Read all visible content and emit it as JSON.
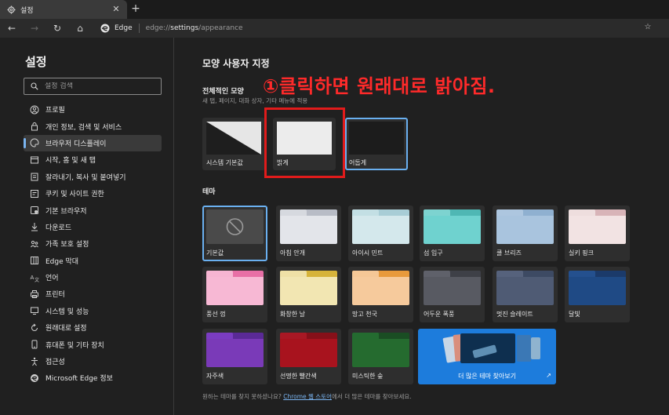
{
  "tab": {
    "title": "설정",
    "close": "✕",
    "new_tab": "+"
  },
  "nav": {
    "back": "←",
    "forward": "→",
    "refresh": "↻",
    "home": "⌂"
  },
  "address": {
    "site_label": "Edge",
    "url_prefix": "edge://",
    "url_bold": "settings",
    "url_suffix": "/appearance"
  },
  "sidebar": {
    "title": "설정",
    "search_placeholder": "설정 검색",
    "items": [
      {
        "label": "프로필",
        "icon": "profile-icon"
      },
      {
        "label": "개인 정보, 검색 및 서비스",
        "icon": "lock-icon"
      },
      {
        "label": "브라우저 디스플레이",
        "icon": "palette-icon",
        "active": true
      },
      {
        "label": "시작, 홈 및 새 탭",
        "icon": "start-icon"
      },
      {
        "label": "잘라내기, 복사 및 붙여넣기",
        "icon": "clipboard-icon"
      },
      {
        "label": "쿠키 및 사이트 권한",
        "icon": "site-permissions-icon"
      },
      {
        "label": "기본 브라우저",
        "icon": "default-browser-icon"
      },
      {
        "label": "다운로드",
        "icon": "download-icon"
      },
      {
        "label": "가족 보호 설정",
        "icon": "family-icon"
      },
      {
        "label": "Edge 막대",
        "icon": "edge-bar-icon"
      },
      {
        "label": "언어",
        "icon": "language-icon"
      },
      {
        "label": "프린터",
        "icon": "printer-icon"
      },
      {
        "label": "시스템 및 성능",
        "icon": "system-icon"
      },
      {
        "label": "원래대로 설정",
        "icon": "reset-icon"
      },
      {
        "label": "휴대폰 및 기타 장치",
        "icon": "phone-icon"
      },
      {
        "label": "접근성",
        "icon": "accessibility-icon"
      },
      {
        "label": "Microsoft Edge 정보",
        "icon": "edge-logo-icon"
      }
    ]
  },
  "main": {
    "title": "모양 사용자 지정",
    "overall_title": "전체적인 모양",
    "overall_sub": "새 탭, 페이지, 대화 상자, 기타 메뉴에 적용",
    "annotation": "①클릭하면 원래대로 밝아짐.",
    "modes": [
      {
        "label": "시스템 기본값"
      },
      {
        "label": "밝게"
      },
      {
        "label": "어둡게",
        "selected": true
      }
    ],
    "theme_title": "테마",
    "themes": [
      {
        "label": "기본값",
        "selected": true,
        "strip": "#3a3a3a",
        "tab": "#3a3a3a",
        "body": "#4a4a4a"
      },
      {
        "label": "아침 안개",
        "strip": "#b8bcc6",
        "tab": "#d6d9df",
        "body": "#e3e5ea"
      },
      {
        "label": "아이시 민트",
        "strip": "#a8cdd6",
        "tab": "#c3dfe4",
        "body": "#d4e8ec"
      },
      {
        "label": "섬 입구",
        "strip": "#4fb7b4",
        "tab": "#7dd3d0",
        "body": "#6fd2cf"
      },
      {
        "label": "쿨 브리즈",
        "strip": "#8fb0d0",
        "tab": "#adc6df",
        "body": "#a9c4de"
      },
      {
        "label": "실키 핑크",
        "strip": "#d8b4b8",
        "tab": "#eedede",
        "body": "#f2e3e3"
      },
      {
        "label": "풍선 껌",
        "strip": "#e86fa6",
        "tab": "#f6b5d2",
        "body": "#f7b8d4"
      },
      {
        "label": "화창한 날",
        "strip": "#d6b33a",
        "tab": "#efe0a6",
        "body": "#f2e6b2"
      },
      {
        "label": "망고 천국",
        "strip": "#e89a3c",
        "tab": "#f5c796",
        "body": "#f6ca9c"
      },
      {
        "label": "어두운 폭풍",
        "strip": "#3e4047",
        "tab": "#5f616a",
        "body": "#585a62"
      },
      {
        "label": "멋진 슬레이트",
        "strip": "#3d4a63",
        "tab": "#56627c",
        "body": "#4f5b74"
      },
      {
        "label": "달빛",
        "strip": "#1b3a6a",
        "tab": "#24508e",
        "body": "#1f4a85"
      },
      {
        "label": "자주색",
        "strip": "#5a2a96",
        "tab": "#7a3cc0",
        "body": "#7a3ab8"
      },
      {
        "label": "선명한 빨간색",
        "strip": "#861019",
        "tab": "#a81824",
        "body": "#a8131e"
      },
      {
        "label": "미스틱한 숲",
        "strip": "#1a4d23",
        "tab": "#246b30",
        "body": "#256b2f"
      }
    ],
    "more_themes": {
      "label": "더 많은 테마 찾아보기",
      "ext_icon": "↗"
    },
    "footer": {
      "prefix": "원하는 테마를 찾지 못하셨나요? ",
      "link": "Chrome 웹 스토어",
      "suffix": "에서 더 많은 테마를 찾아보세요."
    }
  },
  "colors": {
    "accent": "#6ab0f0",
    "annotation_red": "#ff2a2a",
    "more_blue": "#1d7cdc"
  }
}
